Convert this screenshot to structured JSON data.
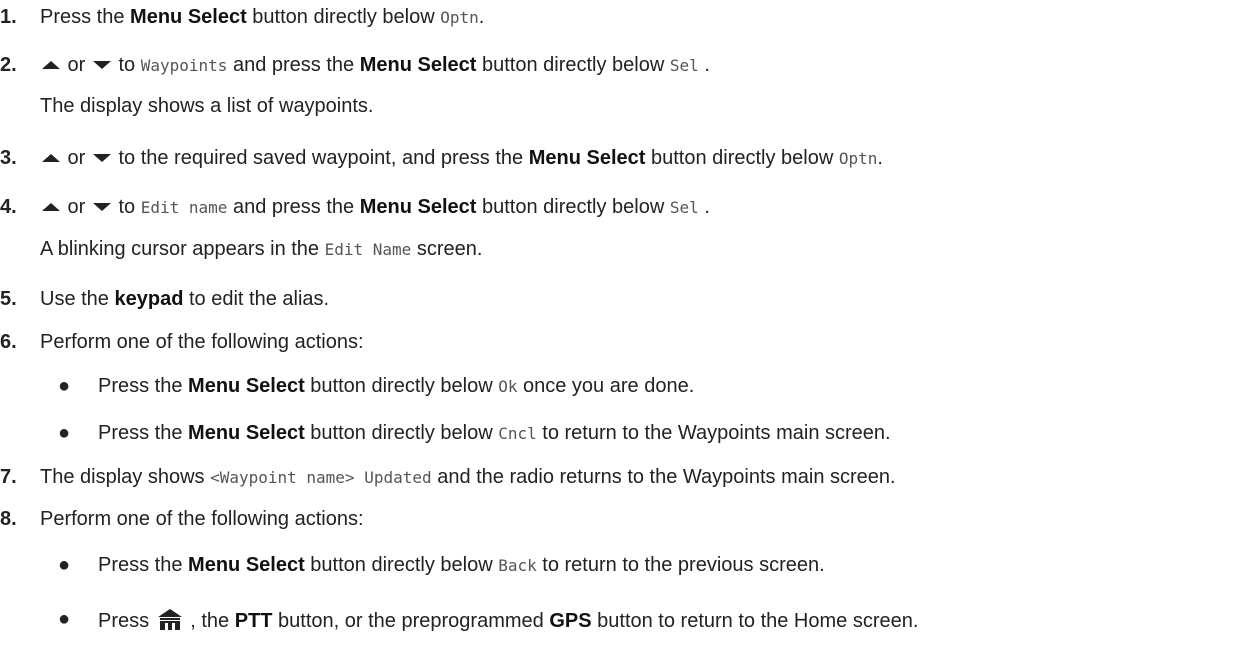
{
  "steps": [
    {
      "num": "1.",
      "t1": "Press the ",
      "b1": "Menu Select",
      "t2": " button directly below ",
      "m1": "Optn",
      "t3": "."
    },
    {
      "num": "2.",
      "t_or": " or ",
      "t_to": " to ",
      "m1": "Waypoints",
      "t2": " and press the ",
      "b1": "Menu Select",
      "t3": " button directly below ",
      "m2": "Sel",
      "t4": " .",
      "sub": "The display shows a list of waypoints."
    },
    {
      "num": "3.",
      "t_or": " or ",
      "t1": " to the required saved waypoint, and press the ",
      "b1": "Menu Select",
      "t2": " button directly below ",
      "m1": "Optn",
      "t3": "."
    },
    {
      "num": "4.",
      "t_or": " or ",
      "t_to": " to ",
      "m1": "Edit name",
      "t2": " and press the ",
      "b1": "Menu Select",
      "t3": " button directly below ",
      "m2": "Sel",
      "t4": " .",
      "sub1": "A blinking cursor appears in the ",
      "sub_m": "Edit Name",
      "sub2": " screen."
    },
    {
      "num": "5.",
      "t1": "Use the ",
      "b1": "keypad",
      "t2": " to edit the alias."
    },
    {
      "num": "6.",
      "t1": "Perform one of the following actions:"
    },
    {
      "num": "7.",
      "t1": "The display shows ",
      "m1": "<Waypoint name> Updated",
      "t2": " and the radio returns to the Waypoints main screen."
    },
    {
      "num": "8.",
      "t1": "Perform one of the following actions:"
    }
  ],
  "bullets6": [
    {
      "t1": "Press the ",
      "b1": "Menu Select",
      "t2": " button directly below ",
      "m1": "Ok",
      "t3": " once you are done."
    },
    {
      "t1": "Press the ",
      "b1": "Menu Select",
      "t2": " button directly below ",
      "m1": "Cncl",
      "t3": " to return to the Waypoints main screen."
    }
  ],
  "bullets8": [
    {
      "t1": "Press the ",
      "b1": "Menu Select",
      "t2": " button directly below ",
      "m1": "Back",
      "t3": " to return to the previous screen."
    },
    {
      "t1": "Press ",
      "t2": " , the ",
      "b1": "PTT",
      "t3": " button, or the preprogrammed ",
      "b2": "GPS",
      "t4": " button to return to the Home screen."
    }
  ],
  "bullet_glyph": "●",
  "icons": {
    "up": "up-arrow-icon",
    "down": "down-arrow-icon",
    "home": "home-icon"
  }
}
